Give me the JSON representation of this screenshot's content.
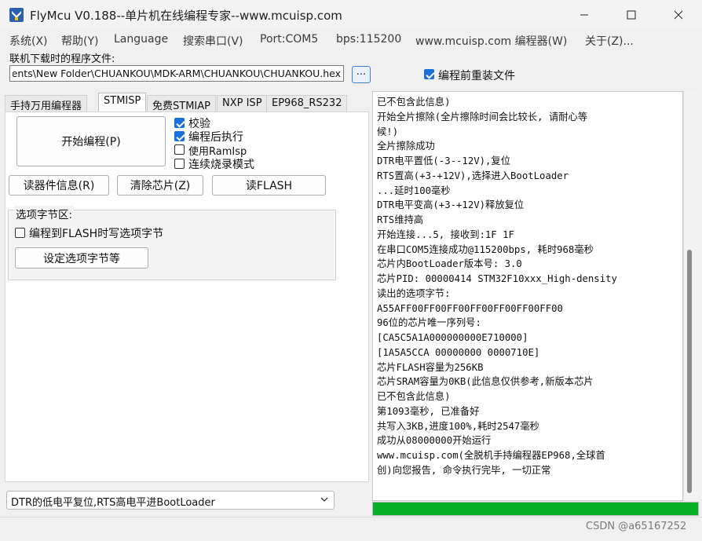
{
  "window": {
    "title": "FlyMcu V0.188--单片机在线编程专家--www.mcuisp.com",
    "minimize_label": "—",
    "maximize_label": "▢",
    "close_label": "✕"
  },
  "menu": [
    "系统(X)",
    "帮助(Y)",
    "Language",
    "搜索串口(V)",
    "Port:COM5",
    "bps:115200",
    "www.mcuisp.com 编程器(W)",
    "关于(Z)..."
  ],
  "file": {
    "label": "联机下载时的程序文件:",
    "path": "ments\\New Folder\\CHUANKOU\\MDK-ARM\\CHUANKOU\\CHUANKOU.hex",
    "browse_label": "...",
    "reload_label": "编程前重装文件",
    "reload_checked": true
  },
  "tabs": [
    "手持万用编程器",
    "STMISP",
    "免费STMIAP",
    "NXP ISP",
    "EP968_RS232"
  ],
  "active_tab": "STMISP",
  "stmisp": {
    "start_button": "开始编程(P)",
    "options": [
      {
        "label": "校验",
        "checked": true
      },
      {
        "label": "编程后执行",
        "checked": true
      },
      {
        "label": "使用RamIsp",
        "checked": false
      },
      {
        "label": "连续烧录模式",
        "checked": false
      }
    ],
    "read_info_button": "读器件信息(R)",
    "erase_button": "清除芯片(Z)",
    "read_flash_button": "读FLASH",
    "option_bytes_title": "选项字节区:",
    "write_option_label": "编程到FLASH时写选项字节",
    "write_option_checked": false,
    "set_option_button": "设定选项字节等",
    "reset_mode": "DTR的低电平复位,RTS高电平进BootLoader"
  },
  "log": [
    "已不包含此信息)",
    "开始全片擦除(全片擦除时间会比较长, 请耐心等",
    "候!)",
    "全片擦除成功",
    "DTR电平置低(-3--12V),复位",
    "RTS置高(+3-+12V),选择进入BootLoader",
    "...延时100毫秒",
    "DTR电平变高(+3-+12V)释放复位",
    "RTS维持高",
    "开始连接...5, 接收到:1F 1F",
    "在串口COM5连接成功@115200bps, 耗时968毫秒",
    "芯片内BootLoader版本号: 3.0",
    "芯片PID: 00000414  STM32F10xxx_High-density",
    "读出的选项字节:",
    "A55AFF00FF00FF00FF00FF00FF00FF00",
    "96位的芯片唯一序列号:",
    "[CA5C5A1A000000000E710000]",
    "[1A5A5CCA 00000000 0000710E]",
    "芯片FLASH容量为256KB",
    "芯片SRAM容量为0KB(此信息仅供参考,新版本芯片",
    "已不包含此信息)",
    "第1093毫秒, 已准备好",
    "共写入3KB,进度100%,耗时2547毫秒",
    "成功从08000000开始运行",
    "www.mcuisp.com(全脱机手持编程器EP968,全球首",
    "创)向您报告, 命令执行完毕, 一切正常"
  ],
  "progress": 1.0,
  "colors": {
    "progress": "#06b025",
    "accent": "#1a6fd8"
  },
  "watermark": "CSDN @a65167252"
}
